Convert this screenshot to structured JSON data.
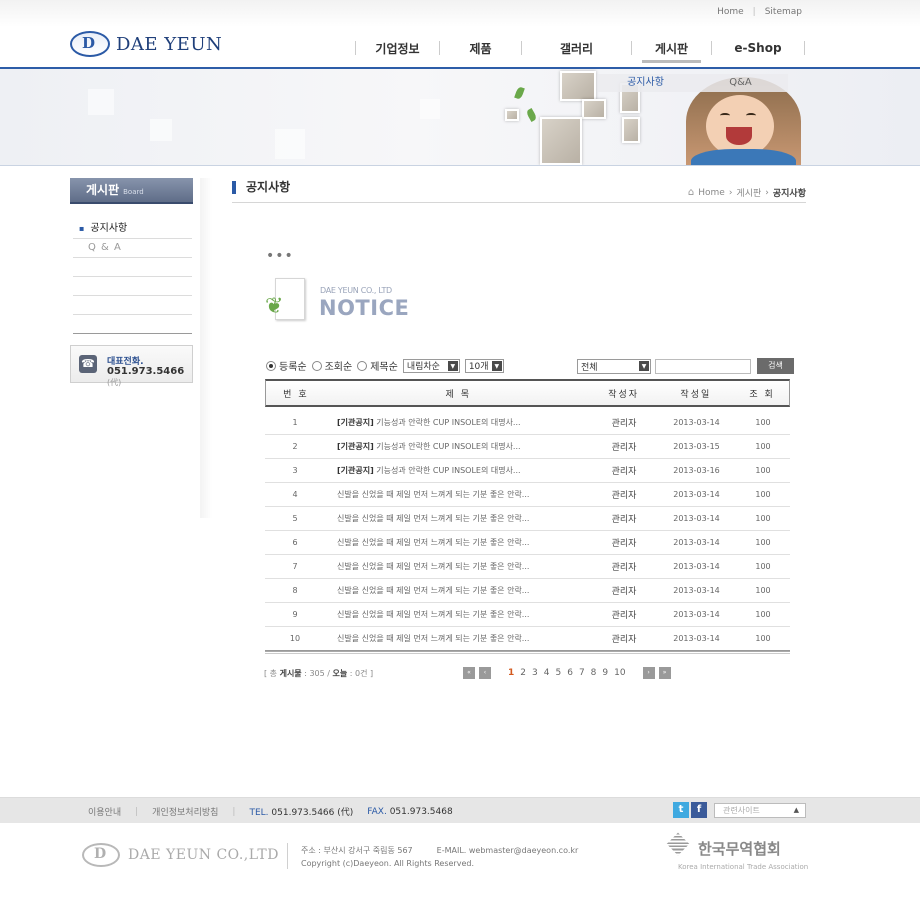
{
  "header": {
    "top_links": [
      "Home",
      "Sitemap"
    ],
    "logo_text": "DAE YEUN",
    "logo_mark": "D",
    "nav": [
      "기업정보",
      "제품",
      "갤러리",
      "게시판",
      "e-Shop"
    ],
    "active_nav": "게시판",
    "accent": "#2d5da8"
  },
  "visual": {
    "subnav": [
      "공지사항",
      "Q&A"
    ],
    "active_subnav": "공지사항"
  },
  "sidebar": {
    "title": "게시판",
    "title_en": "Board",
    "items": [
      "공지사항",
      "Q & A"
    ],
    "call_label": "대표전화.",
    "call_number": "051.973.5466",
    "call_suffix": "(代)",
    "phone_icon": "phone-icon"
  },
  "content": {
    "page_title": "공지사항",
    "breadcrumb": [
      "Home",
      "게시판",
      "공지사항"
    ],
    "dots": "•••",
    "notice_company": "DAE YEUN CO., LTD",
    "notice_heading": "NOTICE"
  },
  "search": {
    "sort_options": [
      "등록순",
      "조회순",
      "제목순"
    ],
    "selected_sort": "등록순",
    "order_value": "내림차순",
    "count_value": "10개",
    "category_value": "전체",
    "query": "",
    "search_label": "검색"
  },
  "board": {
    "columns": [
      "번 호",
      "제 목",
      "작성자",
      "작성일",
      "조 회"
    ],
    "rows": [
      {
        "no": "1",
        "tag": "[기관공지]",
        "title": " 기능성과 안락한 CUP INSOLE의 대명사...",
        "author": "관리자",
        "date": "2013-03-14",
        "views": "100"
      },
      {
        "no": "2",
        "tag": "[기관공지]",
        "title": " 기능성과 안락한 CUP INSOLE의 대명사...",
        "author": "관리자",
        "date": "2013-03-15",
        "views": "100"
      },
      {
        "no": "3",
        "tag": "[기관공지]",
        "title": " 기능성과 안락한 CUP INSOLE의 대명사...",
        "author": "관리자",
        "date": "2013-03-16",
        "views": "100"
      },
      {
        "no": "4",
        "tag": "",
        "title": "신발을 신었을 때 제일 먼저 느껴게 되는 기분 좋은 안락...",
        "author": "관리자",
        "date": "2013-03-14",
        "views": "100"
      },
      {
        "no": "5",
        "tag": "",
        "title": "신발을 신었을 때 제일 먼저 느껴게 되는 기분 좋은 안락...",
        "author": "관리자",
        "date": "2013-03-14",
        "views": "100"
      },
      {
        "no": "6",
        "tag": "",
        "title": "신발을 신었을 때 제일 먼저 느껴게 되는 기분 좋은 안락...",
        "author": "관리자",
        "date": "2013-03-14",
        "views": "100"
      },
      {
        "no": "7",
        "tag": "",
        "title": "신발을 신었을 때 제일 먼저 느껴게 되는 기분 좋은 안락...",
        "author": "관리자",
        "date": "2013-03-14",
        "views": "100"
      },
      {
        "no": "8",
        "tag": "",
        "title": "신발을 신었을 때 제일 먼저 느껴게 되는 기분 좋은 안락...",
        "author": "관리자",
        "date": "2013-03-14",
        "views": "100"
      },
      {
        "no": "9",
        "tag": "",
        "title": "신발을 신었을 때 제일 먼저 느껴게 되는 기분 좋은 안락...",
        "author": "관리자",
        "date": "2013-03-14",
        "views": "100"
      },
      {
        "no": "10",
        "tag": "",
        "title": "신발을 신었을 때 제일 먼저 느껴게 되는 기분 좋은 안락...",
        "author": "관리자",
        "date": "2013-03-14",
        "views": "100"
      }
    ],
    "total_prefix": "[ 총 ",
    "total_label": "게시물",
    "total_value": " : 305 / ",
    "today_label": "오늘",
    "today_value": " : 0건 ]"
  },
  "pager": {
    "pages": [
      "1",
      "2",
      "3",
      "4",
      "5",
      "6",
      "7",
      "8",
      "9",
      "10"
    ],
    "current": "1",
    "first": "«",
    "prev": "‹",
    "next": "›",
    "last": "»"
  },
  "footer": {
    "links": [
      "이용안내",
      "개인정보처리방침"
    ],
    "tel_label": "TEL.",
    "tel": "051.973.5466 (代)",
    "fax_label": "FAX.",
    "fax": "051.973.5468",
    "social": [
      "t",
      "f"
    ],
    "related_sites": "관련사이트",
    "company": "DAE YEUN CO.,LTD",
    "address": "주소 : 부산시 강서구 죽림동 567",
    "email": "E-MAIL. webmaster@daeyeon.co.kr",
    "copyright": "Copyright (c)Daeyeon. All Rights Reserved.",
    "assoc_kr": "한국무역협회",
    "assoc_en": "Korea International Trade Association"
  }
}
